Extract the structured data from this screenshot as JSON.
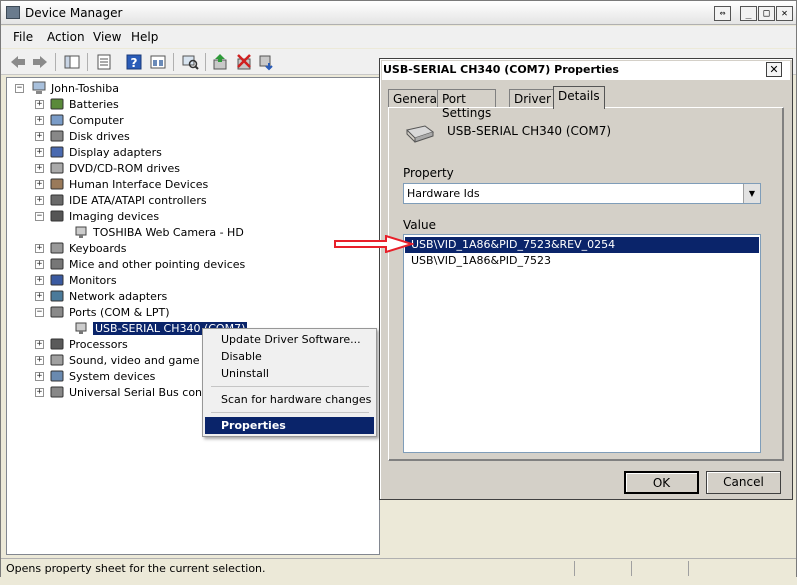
{
  "window": {
    "title": "Device Manager",
    "resize_glyph": "⇔",
    "min_glyph": "_",
    "max_glyph": "□",
    "close_glyph": "✕"
  },
  "menu": [
    "File",
    "Action",
    "View",
    "Help"
  ],
  "toolbar_icons": [
    "back-icon",
    "forward-icon",
    "properties-icon",
    "help-icon",
    "scan-icon",
    "update-driver-icon",
    "uninstall-icon",
    "disable-icon"
  ],
  "tree": {
    "root": "John-Toshiba",
    "nodes": [
      {
        "label": "Batteries",
        "expanded": false
      },
      {
        "label": "Computer",
        "expanded": false
      },
      {
        "label": "Disk drives",
        "expanded": false
      },
      {
        "label": "Display adapters",
        "expanded": false
      },
      {
        "label": "DVD/CD-ROM drives",
        "expanded": false
      },
      {
        "label": "Human Interface Devices",
        "expanded": false
      },
      {
        "label": "IDE ATA/ATAPI controllers",
        "expanded": false
      },
      {
        "label": "Imaging devices",
        "expanded": true,
        "children": [
          "TOSHIBA Web Camera - HD"
        ]
      },
      {
        "label": "Keyboards",
        "expanded": false
      },
      {
        "label": "Mice and other pointing devices",
        "expanded": false
      },
      {
        "label": "Monitors",
        "expanded": false
      },
      {
        "label": "Network adapters",
        "expanded": false
      },
      {
        "label": "Ports (COM & LPT)",
        "expanded": true,
        "children": [
          "USB-SERIAL CH340 (COM7)"
        ]
      },
      {
        "label": "Processors",
        "expanded": false
      },
      {
        "label": "Sound, video and game con",
        "expanded": false
      },
      {
        "label": "System devices",
        "expanded": false
      },
      {
        "label": "Universal Serial Bus controll",
        "expanded": false
      }
    ]
  },
  "context_menu": {
    "items": [
      "Update Driver Software...",
      "Disable",
      "Uninstall",
      "Scan for hardware changes",
      "Properties"
    ]
  },
  "status": {
    "text": "Opens property sheet for the current selection."
  },
  "dialog": {
    "title": "USB-SERIAL CH340 (COM7) Properties",
    "close": "✕",
    "tabs": [
      "General",
      "Port Settings",
      "Driver",
      "Details"
    ],
    "device_name": "USB-SERIAL CH340 (COM7)",
    "property_label": "Property",
    "property_value": "Hardware Ids",
    "value_label": "Value",
    "values": [
      "USB\\VID_1A86&PID_7523&REV_0254",
      "USB\\VID_1A86&PID_7523"
    ],
    "ok": "OK",
    "cancel": "Cancel"
  },
  "colors": {
    "selection": "#0a246a",
    "arrow": "#e8202a"
  }
}
